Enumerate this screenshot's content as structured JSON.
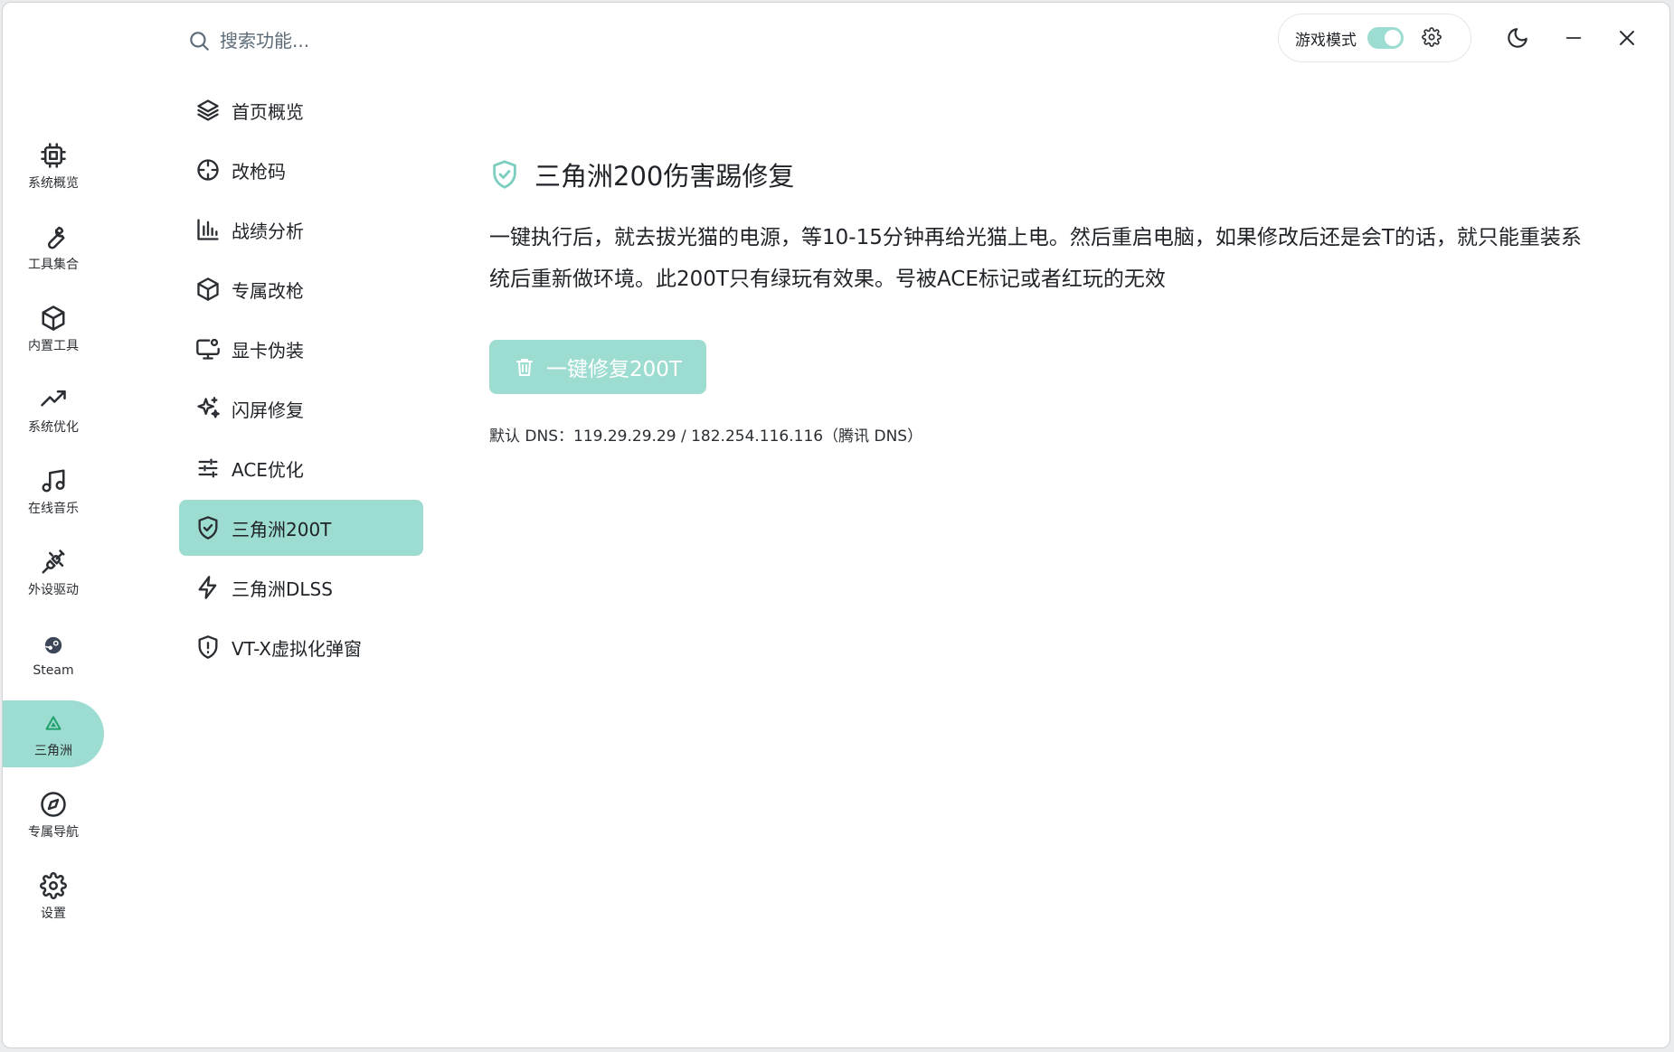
{
  "search": {
    "placeholder": "搜索功能..."
  },
  "topbar": {
    "game_mode_label": "游戏模式",
    "game_mode_on": true,
    "accent_color": "#9ddcd0"
  },
  "rail": {
    "items": [
      {
        "label": "系统概览",
        "icon": "cpu-icon"
      },
      {
        "label": "工具集合",
        "icon": "wrench-icon"
      },
      {
        "label": "内置工具",
        "icon": "cube-icon"
      },
      {
        "label": "系统优化",
        "icon": "trending-up-icon"
      },
      {
        "label": "在线音乐",
        "icon": "music-icon"
      },
      {
        "label": "外设驱动",
        "icon": "plug-icon"
      },
      {
        "label": "Steam",
        "icon": "steam-icon"
      },
      {
        "label": "三角洲",
        "icon": "triangle-icon",
        "active": true
      },
      {
        "label": "专属导航",
        "icon": "compass-icon"
      },
      {
        "label": "设置",
        "icon": "gear-icon"
      }
    ]
  },
  "submenu": {
    "items": [
      {
        "label": "首页概览",
        "icon": "layers-icon"
      },
      {
        "label": "改枪码",
        "icon": "crosshair-icon"
      },
      {
        "label": "战绩分析",
        "icon": "bar-chart-icon"
      },
      {
        "label": "专属改枪",
        "icon": "cube-icon"
      },
      {
        "label": "显卡伪装",
        "icon": "monitor-settings-icon"
      },
      {
        "label": "闪屏修复",
        "icon": "sparkles-icon"
      },
      {
        "label": "ACE优化",
        "icon": "sliders-icon"
      },
      {
        "label": "三角洲200T",
        "icon": "shield-check-icon",
        "active": true
      },
      {
        "label": "三角洲DLSS",
        "icon": "lightning-icon"
      },
      {
        "label": "VT-X虚拟化弹窗",
        "icon": "shield-alert-icon"
      }
    ]
  },
  "main": {
    "title": "三角洲200伤害踢修复",
    "description": "一键执行后，就去拔光猫的电源，等10-15分钟再给光猫上电。然后重启电脑，如果修改后还是会T的话，就只能重装系统后重新做环境。此200T只有绿玩有效果。号被ACE标记或者红玩的无效",
    "button_label": "一键修复200T",
    "dns_note": "默认 DNS：119.29.29.29 / 182.254.116.116（腾讯 DNS）"
  }
}
